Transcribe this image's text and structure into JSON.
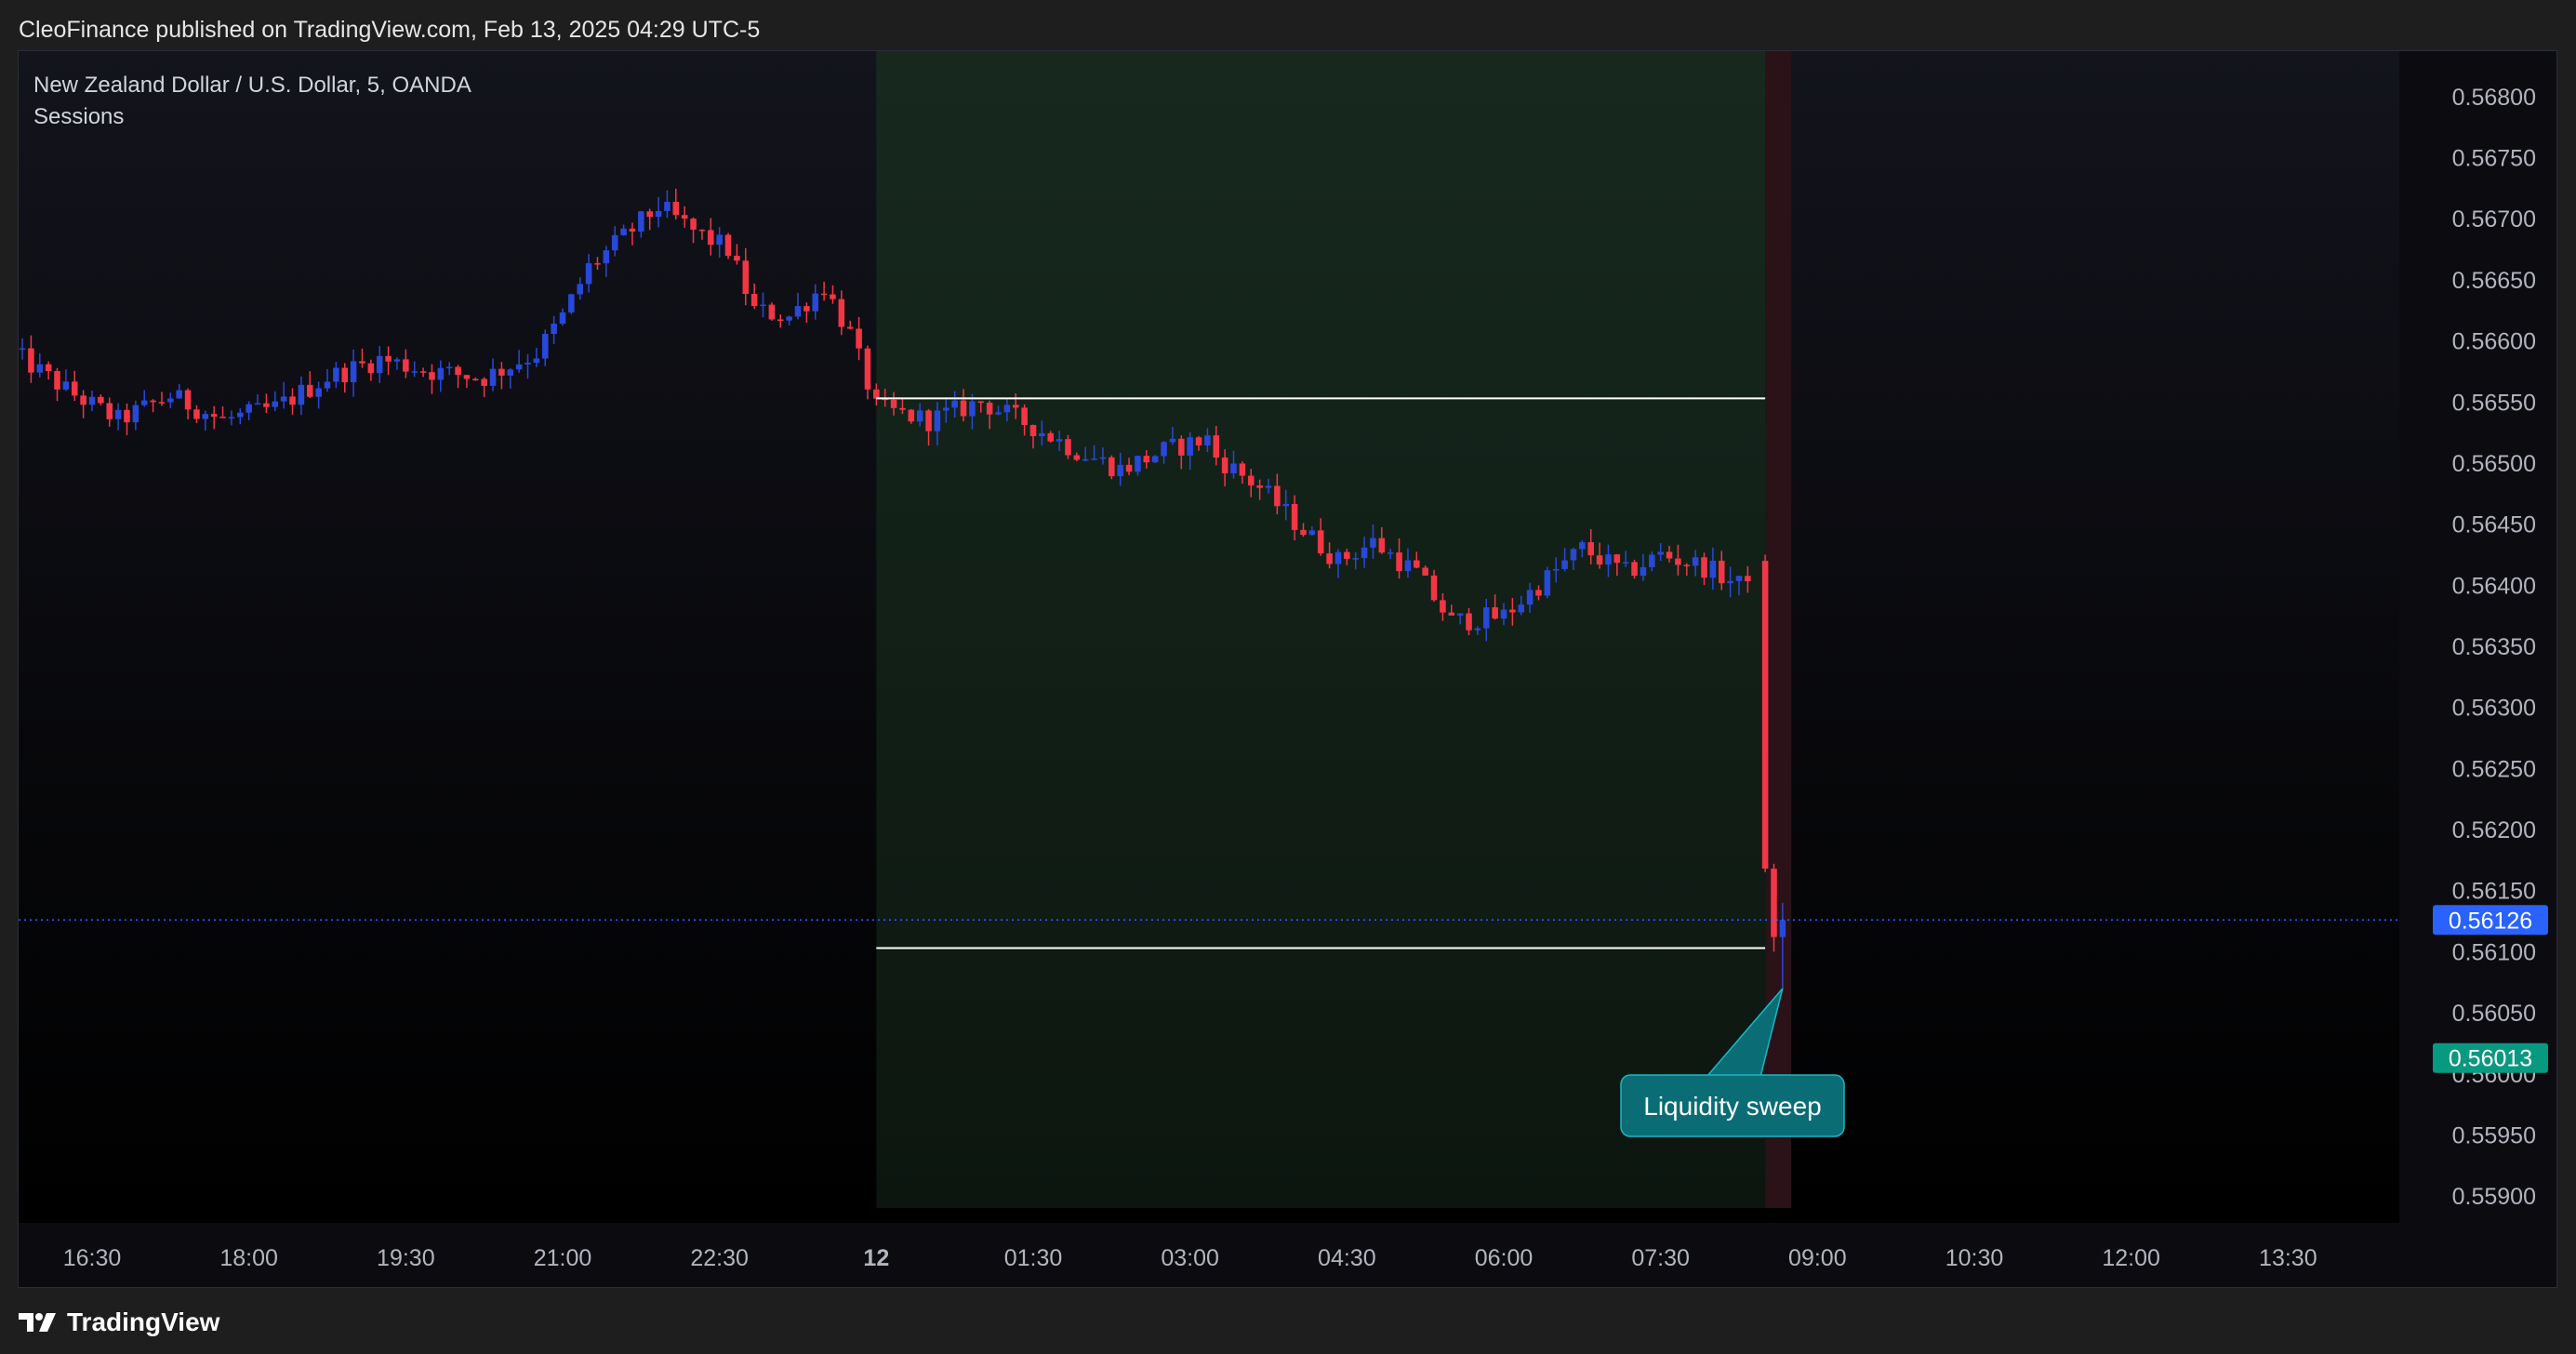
{
  "header": {
    "published": "CleoFinance published on TradingView.com, Feb 13, 2025 04:29 UTC-5"
  },
  "legend": {
    "symbol": "New Zealand Dollar / U.S. Dollar, 5, OANDA",
    "indicator": "Sessions"
  },
  "footer": {
    "brand": "TradingView"
  },
  "colors": {
    "bg": "#0b0b10",
    "up": "#2848d8",
    "down": "#f23645",
    "session_green": "#17291f",
    "session_red": "#2a1218",
    "last_price": "#2962ff",
    "target_price": "#089981",
    "annotation": "#0a6d75",
    "axis_text": "#b2b5be"
  },
  "chart_data": {
    "type": "candlestick",
    "symbol": "NZDUSD",
    "interval": "5",
    "ylim": [
      0.55875,
      0.56825
    ],
    "y_ticks": [
      "0.56800",
      "0.56750",
      "0.56700",
      "0.56650",
      "0.56600",
      "0.56550",
      "0.56500",
      "0.56450",
      "0.56400",
      "0.56350",
      "0.56300",
      "0.56250",
      "0.56200",
      "0.56150",
      "0.56100",
      "0.56050",
      "0.56000",
      "0.55950",
      "0.55900"
    ],
    "x_ticks": [
      {
        "label": "16:30",
        "t": "16:30"
      },
      {
        "label": "18:00",
        "t": "18:00"
      },
      {
        "label": "19:30",
        "t": "19:30"
      },
      {
        "label": "21:00",
        "t": "21:00"
      },
      {
        "label": "22:30",
        "t": "22:30"
      },
      {
        "label": "12",
        "t": "24:00",
        "bold": true
      },
      {
        "label": "01:30",
        "t": "25:30"
      },
      {
        "label": "03:00",
        "t": "27:00"
      },
      {
        "label": "04:30",
        "t": "28:30"
      },
      {
        "label": "06:00",
        "t": "30:00"
      },
      {
        "label": "07:30",
        "t": "31:30"
      },
      {
        "label": "09:00",
        "t": "33:00"
      },
      {
        "label": "10:30",
        "t": "34:30"
      },
      {
        "label": "12:00",
        "t": "36:00"
      },
      {
        "label": "13:30",
        "t": "37:30"
      }
    ],
    "anchors": [
      [
        "15:45",
        0.5659
      ],
      [
        "16:15",
        0.5656
      ],
      [
        "16:45",
        0.56535
      ],
      [
        "17:15",
        0.56555
      ],
      [
        "17:45",
        0.56535
      ],
      [
        "18:15",
        0.56545
      ],
      [
        "18:45",
        0.5657
      ],
      [
        "19:15",
        0.56585
      ],
      [
        "19:45",
        0.56575
      ],
      [
        "20:15",
        0.5657
      ],
      [
        "20:45",
        0.5659
      ],
      [
        "21:00",
        0.5662
      ],
      [
        "21:15",
        0.5666
      ],
      [
        "21:35",
        0.56685
      ],
      [
        "21:55",
        0.5671
      ],
      [
        "22:15",
        0.5669
      ],
      [
        "22:35",
        0.56675
      ],
      [
        "22:50",
        0.56625
      ],
      [
        "23:10",
        0.5662
      ],
      [
        "23:30",
        0.56645
      ],
      [
        "23:45",
        0.56605
      ],
      [
        "24:00",
        0.56545
      ],
      [
        "24:30",
        0.56535
      ],
      [
        "25:00",
        0.5655
      ],
      [
        "25:30",
        0.5653
      ],
      [
        "25:55",
        0.5651
      ],
      [
        "26:20",
        0.56495
      ],
      [
        "26:45",
        0.5651
      ],
      [
        "27:10",
        0.5652
      ],
      [
        "27:15",
        0.56505
      ],
      [
        "27:40",
        0.5648
      ],
      [
        "28:05",
        0.56445
      ],
      [
        "28:25",
        0.5642
      ],
      [
        "28:45",
        0.56435
      ],
      [
        "29:10",
        0.5641
      ],
      [
        "29:30",
        0.5637
      ],
      [
        "30:00",
        0.56375
      ],
      [
        "30:20",
        0.564
      ],
      [
        "30:45",
        0.5643
      ],
      [
        "31:10",
        0.5641
      ],
      [
        "31:30",
        0.56425
      ],
      [
        "31:55",
        0.56415
      ],
      [
        "32:15",
        0.564
      ],
      [
        "32:25",
        0.5642
      ]
    ],
    "final_candles": [
      {
        "t": "32:30",
        "o": 0.5642,
        "h": 0.56425,
        "l": 0.56165,
        "c": 0.56168
      },
      {
        "t": "32:35",
        "o": 0.56168,
        "h": 0.56172,
        "l": 0.561,
        "c": 0.56112
      },
      {
        "t": "32:40",
        "o": 0.56112,
        "h": 0.5614,
        "l": 0.5607,
        "c": 0.56126
      }
    ],
    "sessions": [
      {
        "from": "24:00",
        "to": "32:30",
        "color": "green"
      },
      {
        "from": "32:30",
        "to": "32:45",
        "color": "red"
      }
    ],
    "range_lines": [
      {
        "price": 0.56553,
        "from": "24:00",
        "to": "32:30"
      },
      {
        "price": 0.56103,
        "from": "24:00",
        "to": "32:30"
      }
    ],
    "last_price": {
      "value": 0.56126,
      "label": "0.56126"
    },
    "target_price": {
      "value": 0.56013,
      "label": "0.56013"
    },
    "annotation": {
      "text": "Liquidity sweep",
      "t": "32:40",
      "price": 0.5607
    }
  }
}
